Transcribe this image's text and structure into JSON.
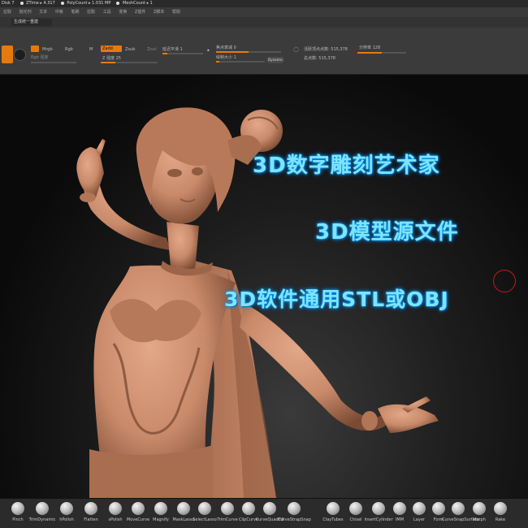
{
  "status_bar": {
    "disk": "Disk 7",
    "ztime": "ZTime ▸ 4.317",
    "polycount": "PolyCount ▸ 1.031 MP",
    "meshcount": "MeshCount ▸ 1"
  },
  "menu": [
    "拉取",
    "抛光剂",
    "文本",
    "中板",
    "笔刷",
    "拉取",
    "工具",
    "变换",
    "Z插件",
    "Z脚本",
    "帮助"
  ],
  "project_tab": "生成统一重建",
  "shelf": {
    "mrgb_label": "Mrgb",
    "rgb_label": "Rgb",
    "m_label": "M",
    "zadd_label": "Zadd",
    "zsub_label": "Zsub",
    "zcut_label": "Zcut",
    "rgb_intensity_label": "Rgb 强度",
    "z_intensity": "Z 强度 25",
    "focal_label": "焦点衰减 0",
    "draw_size": "绘制大小 1",
    "dynamic_label": "Dynamic",
    "smooth_label": "延迟平滑 1",
    "active_points": "活跃顶点点数: 515,378",
    "total_points": "总点数: 515,378",
    "resolution": "分辨率 128"
  },
  "overlay": {
    "line1": "3D数字雕刻艺术家",
    "line2": "3D模型源文件",
    "line3": "3D软件通用STL或OBJ"
  },
  "brushes": [
    "Pinch",
    "TrimDynamic",
    "hPolish",
    "Flatten",
    "sPolish",
    "MoveCurve",
    "Magnify",
    "MaskLasso",
    "SelectLasso",
    "TrimCurve",
    "ClipCurve",
    "CurveQuadFill",
    "CurveStrapSnap",
    "ClayTubes",
    "Chisel",
    "InsertCylinder",
    "IMM",
    "Layer",
    "Form",
    "CurveSnapSurface",
    "Morph",
    "Rake"
  ],
  "colors": {
    "accent": "#e57a0f",
    "overlay_text": "#7fe3ff",
    "model_skin": "#c98a6a",
    "cursor": "#c81a1a"
  }
}
